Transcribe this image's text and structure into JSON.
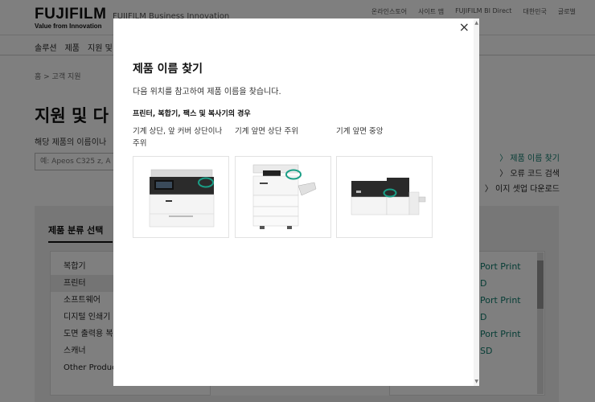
{
  "header": {
    "logo": "FUJIFILM",
    "tagline": "Value from Innovation",
    "brand_sub": "FUJIFILM Business Innovation",
    "util_links": [
      "온라인스토어",
      "사이트 맵",
      "FUJIFILM BI Direct",
      "대한민국",
      "글로벌"
    ]
  },
  "nav": {
    "items": [
      "솔루션",
      "제품",
      "지원 및"
    ]
  },
  "breadcrumb": "홈 > 고객 지원",
  "page_title": "지원 및 다",
  "description": "해당 제품의 이름이나",
  "search": {
    "placeholder": "예: Apeos C325 z, A"
  },
  "side_links": [
    "〉 제품 이름 찾기",
    "〉 오류 코드 검색",
    "〉 이지 셋업 다운로드"
  ],
  "category": {
    "title": "제품 분류 선택",
    "items": [
      "복합기",
      "프린터",
      "소프트웨어",
      "디지털 인쇄기",
      "도면 출력용 복",
      "스캐너",
      "Other Produc"
    ]
  },
  "product_list": [
    "Port Print",
    "D",
    "Port Print",
    "D",
    "Port Print",
    "SD"
  ],
  "modal": {
    "close_label": "×",
    "title": "제품 이름 찾기",
    "description": "다음 위치를 참고하여 제품 이름을 찾습니다.",
    "subtitle": "프린터, 복합기, 팩스 및 복사기의 경우",
    "locations": [
      {
        "label": "기계 상단, 앞 커버 상단이나 주위"
      },
      {
        "label": "기계 앞면 상단 주위"
      },
      {
        "label": "기계 앞면 중앙"
      }
    ],
    "highlight_color": "#1a9e86"
  }
}
